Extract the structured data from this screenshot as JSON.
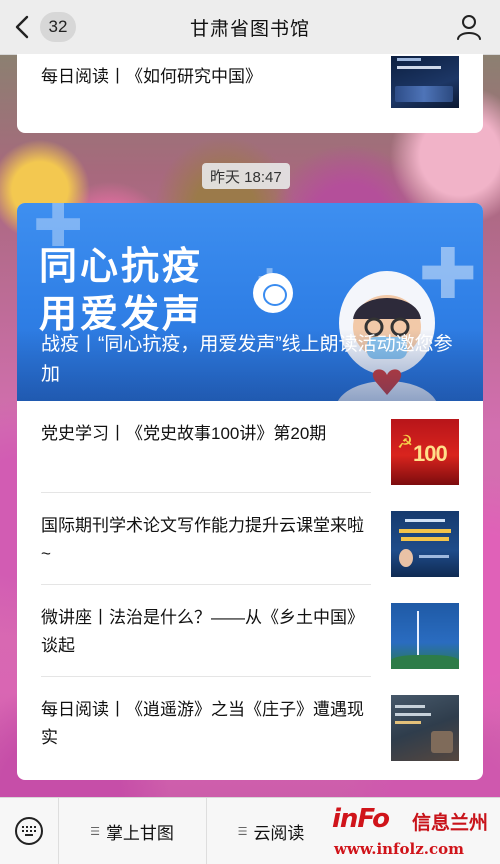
{
  "navbar": {
    "unread_count": "32",
    "title": "甘肃省图书馆"
  },
  "previous_message": {
    "text": "每日阅读丨《如何研究中国》"
  },
  "time_label": "昨天 18:47",
  "main_article": {
    "banner_line1": "同心抗疫",
    "banner_line2": "用爱发声",
    "caption": "战疫丨“同心抗疫，用爱发声”线上朗读活动邀您参加"
  },
  "articles": [
    {
      "title": "党史学习丨《党史故事100讲》第20期",
      "thumb_text": "100"
    },
    {
      "title": "国际期刊学术论文写作能力提升云课堂来啦~"
    },
    {
      "title": "微讲座丨法治是什么？——从《乡土中国》谈起"
    },
    {
      "title": "每日阅读丨《逍遥游》之当《庄子》遭遇现实"
    }
  ],
  "bottom_menu": {
    "item1": "掌上甘图",
    "item2": "云阅读"
  },
  "watermark": {
    "logo": "inFo",
    "name": "信息兰州",
    "url": "www.infolz.com"
  },
  "colors": {
    "banner_blue": "#3a8cf0",
    "watermark_red": "#d0141a"
  }
}
